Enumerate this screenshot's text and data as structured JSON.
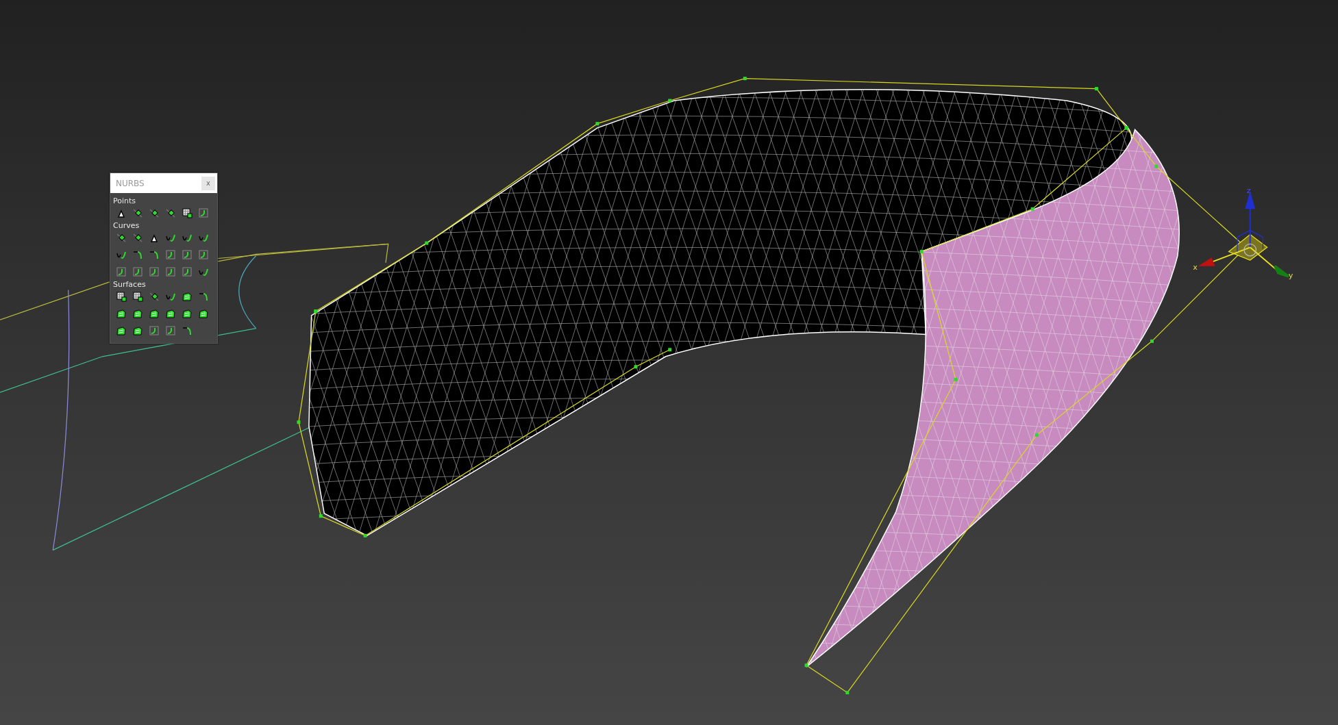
{
  "toolbox": {
    "title": "NURBS",
    "close": "x",
    "sections": [
      {
        "label": "Points",
        "tools": [
          {
            "kind": "point"
          },
          {
            "kind": "dot"
          },
          {
            "kind": "dot"
          },
          {
            "kind": "dot"
          },
          {
            "kind": "patch"
          },
          {
            "kind": "frame"
          }
        ]
      },
      {
        "label": "Curves",
        "tools": [
          {
            "kind": "dot"
          },
          {
            "kind": "dot"
          },
          {
            "kind": "point"
          },
          {
            "kind": "curve"
          },
          {
            "kind": "curve"
          },
          {
            "kind": "curve"
          },
          {
            "kind": "curve"
          },
          {
            "kind": "corner"
          },
          {
            "kind": "corner"
          },
          {
            "kind": "frame"
          },
          {
            "kind": "frame"
          },
          {
            "kind": "frame"
          },
          {
            "kind": "frame"
          },
          {
            "kind": "frame"
          },
          {
            "kind": "frame"
          },
          {
            "kind": "frame"
          },
          {
            "kind": "frame"
          },
          {
            "kind": "curve"
          }
        ]
      },
      {
        "label": "Surfaces",
        "tools": [
          {
            "kind": "patch"
          },
          {
            "kind": "patch"
          },
          {
            "kind": "dot"
          },
          {
            "kind": "curve"
          },
          {
            "kind": "solid"
          },
          {
            "kind": "corner"
          },
          {
            "kind": "solid"
          },
          {
            "kind": "solid"
          },
          {
            "kind": "solid"
          },
          {
            "kind": "solid"
          },
          {
            "kind": "solid"
          },
          {
            "kind": "solid"
          },
          {
            "kind": "solid"
          },
          {
            "kind": "solid"
          },
          {
            "kind": "frame"
          },
          {
            "kind": "frame"
          },
          {
            "kind": "corner"
          }
        ]
      }
    ]
  },
  "axis_gizmo": {
    "labels": [
      {
        "kind": "x",
        "text": "x"
      },
      {
        "kind": "y",
        "text": "y"
      },
      {
        "kind": "z",
        "text": "z"
      }
    ]
  }
}
